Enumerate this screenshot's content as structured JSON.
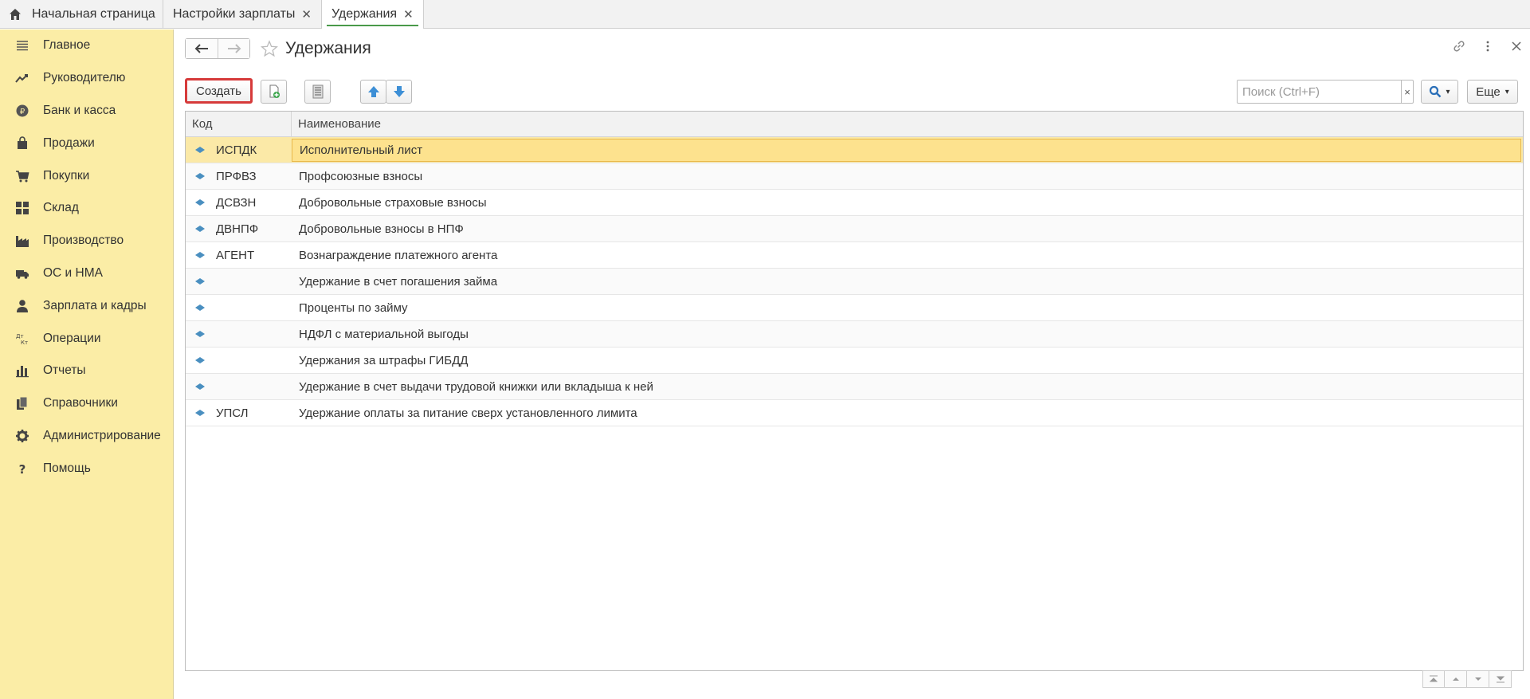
{
  "tabs": {
    "home_label": "Начальная страница",
    "items": [
      {
        "label": "Настройки зарплаты"
      },
      {
        "label": "Удержания"
      }
    ]
  },
  "sidebar": {
    "items": [
      {
        "label": "Главное",
        "icon": "menu-icon"
      },
      {
        "label": "Руководителю",
        "icon": "trend-icon"
      },
      {
        "label": "Банк и касса",
        "icon": "ruble-icon"
      },
      {
        "label": "Продажи",
        "icon": "bag-icon"
      },
      {
        "label": "Покупки",
        "icon": "cart-icon"
      },
      {
        "label": "Склад",
        "icon": "warehouse-icon"
      },
      {
        "label": "Производство",
        "icon": "factory-icon"
      },
      {
        "label": "ОС и НМА",
        "icon": "truck-icon"
      },
      {
        "label": "Зарплата и кадры",
        "icon": "person-icon"
      },
      {
        "label": "Операции",
        "icon": "dt-kt-icon"
      },
      {
        "label": "Отчеты",
        "icon": "bar-chart-icon"
      },
      {
        "label": "Справочники",
        "icon": "books-icon"
      },
      {
        "label": "Администрирование",
        "icon": "gear-icon"
      },
      {
        "label": "Помощь",
        "icon": "help-icon"
      }
    ]
  },
  "header": {
    "title": "Удержания"
  },
  "toolbar": {
    "create_label": "Создать",
    "search_placeholder": "Поиск (Ctrl+F)",
    "clear_label": "×",
    "more_label": "Еще"
  },
  "table": {
    "columns": [
      "Код",
      "Наименование"
    ],
    "rows": [
      {
        "code": "ИСПДК",
        "name": "Исполнительный лист"
      },
      {
        "code": "ПРФВЗ",
        "name": "Профсоюзные взносы"
      },
      {
        "code": "ДСВЗН",
        "name": "Добровольные страховые взносы"
      },
      {
        "code": "ДВНПФ",
        "name": "Добровольные взносы в НПФ"
      },
      {
        "code": "АГЕНТ",
        "name": "Вознаграждение платежного агента"
      },
      {
        "code": "",
        "name": "Удержание в счет погашения займа"
      },
      {
        "code": "",
        "name": "Проценты по займу"
      },
      {
        "code": "",
        "name": "НДФЛ с материальной выгоды"
      },
      {
        "code": "",
        "name": "Удержания за штрафы ГИБДД"
      },
      {
        "code": "",
        "name": "Удержание в счет выдачи трудовой книжки или вкладыша к ней"
      },
      {
        "code": "УПСЛ",
        "name": "Удержание оплаты за питание сверх установленного лимита"
      }
    ]
  },
  "colors": {
    "sidebar_bg": "#fbeda6",
    "selected_row": "#fde28e",
    "create_highlight": "#d63a3a",
    "diamond": "#4a8fc0"
  }
}
